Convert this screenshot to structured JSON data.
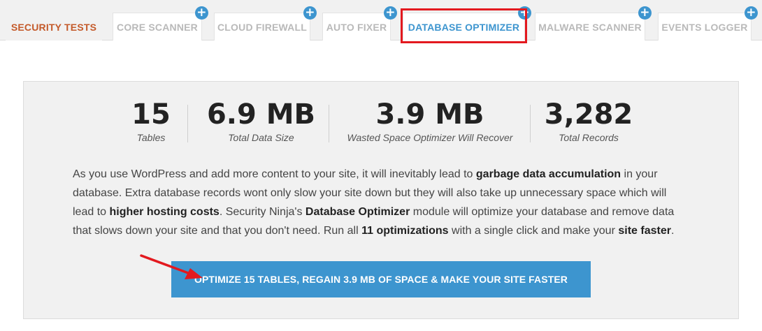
{
  "tabs": [
    {
      "label": "SECURITY TESTS",
      "plus": false
    },
    {
      "label": "CORE SCANNER",
      "plus": true
    },
    {
      "label": "CLOUD FIREWALL",
      "plus": true
    },
    {
      "label": "AUTO FIXER",
      "plus": true
    },
    {
      "label": "DATABASE OPTIMIZER",
      "plus": true
    },
    {
      "label": "MALWARE SCANNER",
      "plus": true
    },
    {
      "label": "EVENTS LOGGER",
      "plus": true
    }
  ],
  "plus_glyph": "+",
  "colors": {
    "accent": "#3d95cf",
    "active_tab": "#c45a2a",
    "highlight": "#e3191f",
    "arrow": "#e3191f"
  },
  "stats": [
    {
      "value": "15",
      "label": "Tables"
    },
    {
      "value": "6.9 MB",
      "label": "Total Data Size"
    },
    {
      "value": "3.9 MB",
      "label": "Wasted Space Optimizer Will Recover"
    },
    {
      "value": "3,282",
      "label": "Total Records"
    }
  ],
  "description": {
    "p1": "As you use WordPress and add more content to your site, it will inevitably lead to ",
    "b1": "garbage data accumulation",
    "p2": " in your database. Extra database records wont only slow your site down but they will also take up unnecessary space which will lead to ",
    "b2": "higher hosting costs",
    "p3": ". Security Ninja's ",
    "b3": "Database Optimizer",
    "p4": " module will optimize your database and remove data that slows down your site and that you don't need. Run all ",
    "b4": "11 optimizations",
    "p5": " with a single click and make your ",
    "b5": "site faster",
    "p6": "."
  },
  "cta_label": "OPTIMIZE 15 TABLES, REGAIN 3.9 MB OF SPACE & MAKE YOUR SITE FASTER"
}
